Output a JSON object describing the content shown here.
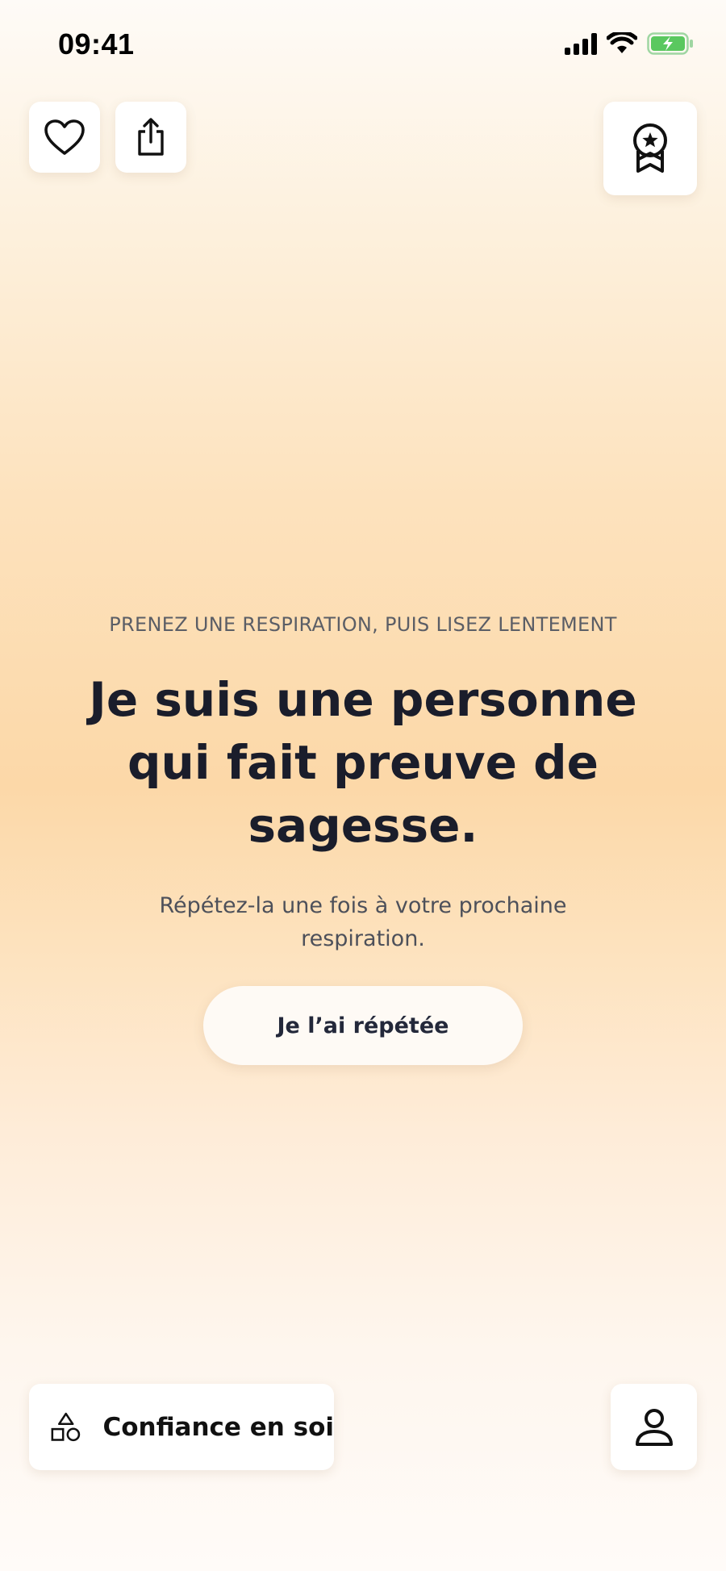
{
  "status_bar": {
    "time": "09:41"
  },
  "toolbar": {
    "favorite_icon": "heart-icon",
    "share_icon": "share-icon",
    "award_icon": "award-badge-icon"
  },
  "content": {
    "instruction": "PRENEZ UNE RESPIRATION, PUIS LISEZ LENTEMENT",
    "affirmation": "Je suis une personne qui fait preuve de sagesse.",
    "hint": "Répétez-la une fois à votre prochaine respiration.",
    "repeat_button_label": "Je l’ai répétée"
  },
  "bottom_bar": {
    "category_label": "Confiance en soi",
    "category_icon": "shapes-icon",
    "profile_icon": "person-icon"
  },
  "colors": {
    "gradient_peak": "#fcd8a8",
    "text_dark": "#1a1d2b",
    "battery_green": "#5ac85f"
  }
}
